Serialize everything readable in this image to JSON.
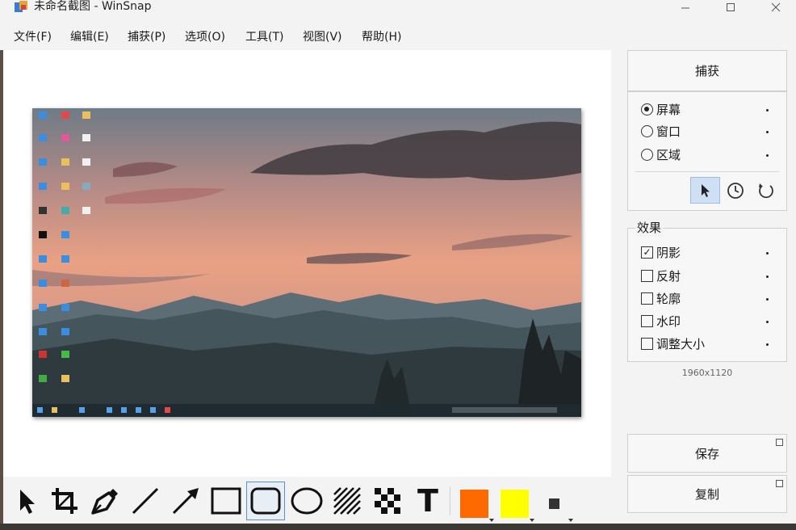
{
  "window": {
    "title": "未命名截图 - WinSnap",
    "minimize": "—",
    "maximize": "☐",
    "close": "✕"
  },
  "menu": [
    "文件(F)",
    "编辑(E)",
    "捕获(P)",
    "选项(O)",
    "工具(T)",
    "视图(V)",
    "帮助(H)"
  ],
  "capture": {
    "button": "捕获",
    "modes": [
      {
        "label": "屏幕",
        "selected": true
      },
      {
        "label": "窗口",
        "selected": false
      },
      {
        "label": "区域",
        "selected": false
      }
    ],
    "icons": [
      "cursor-icon",
      "timer-icon",
      "repeat-icon"
    ]
  },
  "effects": {
    "title": "效果",
    "items": [
      {
        "label": "阴影",
        "checked": true
      },
      {
        "label": "反射",
        "checked": false
      },
      {
        "label": "轮廓",
        "checked": false
      },
      {
        "label": "水印",
        "checked": false
      },
      {
        "label": "调整大小",
        "checked": false
      }
    ]
  },
  "image_size": "1960x1120",
  "actions": {
    "save": "保存",
    "copy": "复制"
  },
  "tools": [
    "select-tool",
    "crop-tool",
    "pen-tool",
    "line-tool",
    "arrow-tool",
    "rectangle-tool",
    "rounded-rectangle-tool",
    "ellipse-tool",
    "hatch-tool",
    "pixelate-tool",
    "text-tool"
  ],
  "tool_labels": {
    "text": "T"
  },
  "colors": {
    "primary": "#ff6a00",
    "secondary": "#ffff00",
    "accent": "#5b8fd6"
  }
}
